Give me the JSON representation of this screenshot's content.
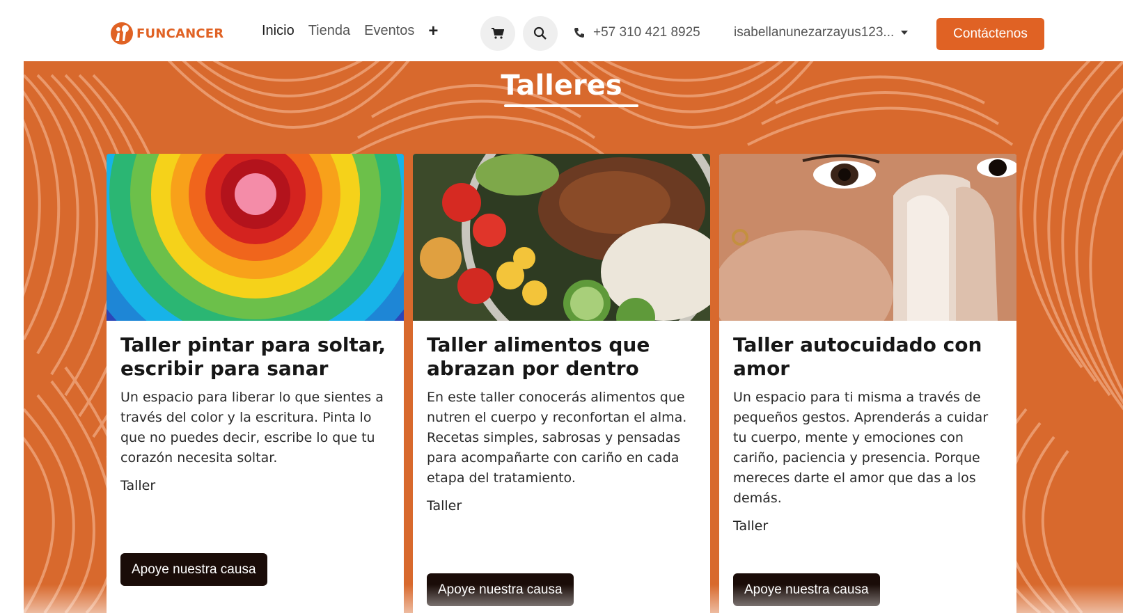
{
  "brand": {
    "name": "FUNCANCER",
    "color": "#e06224"
  },
  "nav": {
    "items": [
      {
        "label": "Inicio",
        "active": true
      },
      {
        "label": "Tienda",
        "active": false
      },
      {
        "label": "Eventos",
        "active": false
      }
    ],
    "more_icon": "plus-icon"
  },
  "header": {
    "cart_icon": "cart-icon",
    "search_icon": "search-icon",
    "phone": "+57 310 421 8925",
    "user": "isabellanunezarzayus123...",
    "contact_label": "Contáctenos"
  },
  "section": {
    "title": "Talleres",
    "band_color": "#d8692d"
  },
  "cards": [
    {
      "title": "Taller pintar para soltar, escribir para sanar",
      "description": "Un espacio para liberar lo que sientes a través del color y la escritura. Pinta lo que no puedes decir, escribe lo que tu corazón necesita soltar.",
      "tag": "Taller",
      "button": "Apoye nuestra causa",
      "image": "rainbow-circles-image"
    },
    {
      "title": "Taller alimentos que abrazan por dentro",
      "description": "En este taller conocerás alimentos que nutren el cuerpo y reconfortan el alma. Recetas simples, sabrosas y pensadas para acompañarte con cariño en cada etapa del tratamiento.",
      "tag": "Taller",
      "button": "Apoye nuestra causa",
      "image": "food-bowl-image"
    },
    {
      "title": "Taller autocuidado con amor",
      "description": "Un espacio para ti misma a través de pequeños gestos. Aprenderás a cuidar tu cuerpo, mente y emociones con cariño, paciencia y presencia. Porque mereces darte el amor que das a los demás.",
      "tag": "Taller",
      "button": "Apoye nuestra causa",
      "image": "face-wash-image"
    }
  ]
}
